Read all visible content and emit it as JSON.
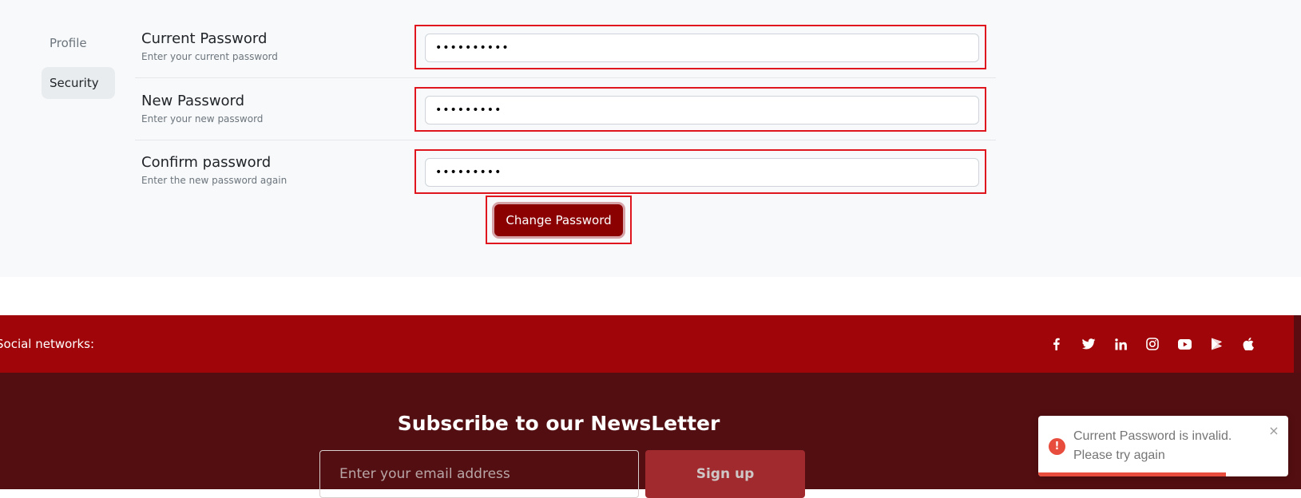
{
  "sidebar": {
    "items": [
      {
        "label": "Profile"
      },
      {
        "label": "Security"
      }
    ],
    "active": "Security"
  },
  "form": {
    "current": {
      "title": "Current Password",
      "hint": "Enter your current password",
      "value": "••••••••••"
    },
    "new": {
      "title": "New Password",
      "hint": "Enter your new password",
      "value": "•••••••••"
    },
    "confirm": {
      "title": "Confirm password",
      "hint": "Enter the new password again",
      "value": "•••••••••"
    },
    "submit_label": "Change Password"
  },
  "social": {
    "label": "Social networks:",
    "icons": [
      "facebook-icon",
      "twitter-icon",
      "linkedin-icon",
      "instagram-icon",
      "youtube-icon",
      "google-play-icon",
      "apple-icon"
    ]
  },
  "newsletter": {
    "title": "Subscribe to our NewsLetter",
    "placeholder": "Enter your email address",
    "button_label": "Sign up"
  },
  "toast": {
    "message": "Current Password is invalid. Please try again",
    "close_glyph": "×",
    "icon_glyph": "!",
    "progress_remaining": 0.75
  },
  "colors": {
    "highlight": "#e0161f",
    "button": "#8b0000",
    "social_bar": "#a00509",
    "footer": "#530e11",
    "error": "#e74c3c"
  }
}
